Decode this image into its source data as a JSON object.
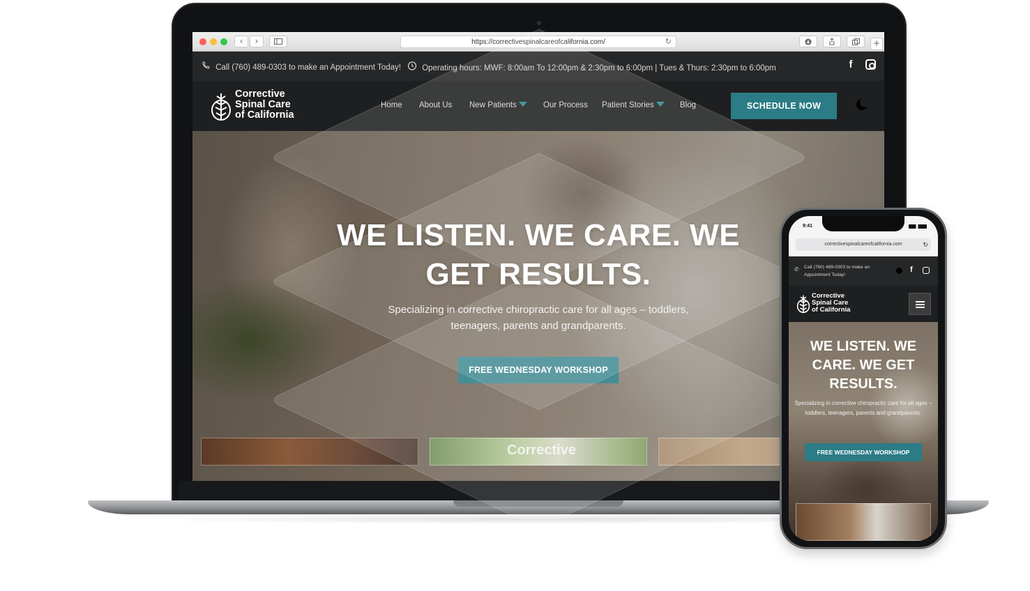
{
  "browser": {
    "url": "https://correctivespinalcareofcalifornia.com/"
  },
  "topbar": {
    "call_text": "Call (760) 489-0303 to make an Appointment Today!",
    "hours_text": "Operating hours: MWF: 8:00am To 12:00pm & 2:30pm to 6:00pm | Tues & Thurs: 2:30pm to 6:00pm",
    "social": [
      "facebook-icon",
      "instagram-icon"
    ]
  },
  "logo": {
    "line1": "Corrective",
    "line2": "Spinal Care",
    "line3": "of California"
  },
  "nav": {
    "items": [
      {
        "label": "Home"
      },
      {
        "label": "About Us"
      },
      {
        "label": "New Patients"
      },
      {
        "label": "Our Process"
      },
      {
        "label": "Patient Stories"
      },
      {
        "label": "Blog"
      }
    ],
    "cta": "SCHEDULE NOW"
  },
  "hero": {
    "title": "WE LISTEN. WE CARE. WE GET RESULTS.",
    "subtitle": "Specializing in corrective chiropractic care for all ages – toddlers, teenagers, parents and grandparents.",
    "button": "FREE WEDNESDAY WORKSHOP",
    "thumb_caption": "Corrective"
  },
  "phone": {
    "time": "9:41",
    "url": "correctivespinalcareofcalifornia.com",
    "call_text": "Call (760) 489-0303 to make an Appointment Today!",
    "title": "WE LISTEN. WE CARE. WE GET RESULTS.",
    "subtitle": "Specializing in corrective chiropractic care for all ages – toddlers, teenagers, parents and grandparents.",
    "button": "FREE WEDNESDAY WORKSHOP"
  },
  "colors": {
    "accent": "#2b7c86",
    "topbar_bg": "#262728",
    "nav_bg": "#1e1f20"
  }
}
